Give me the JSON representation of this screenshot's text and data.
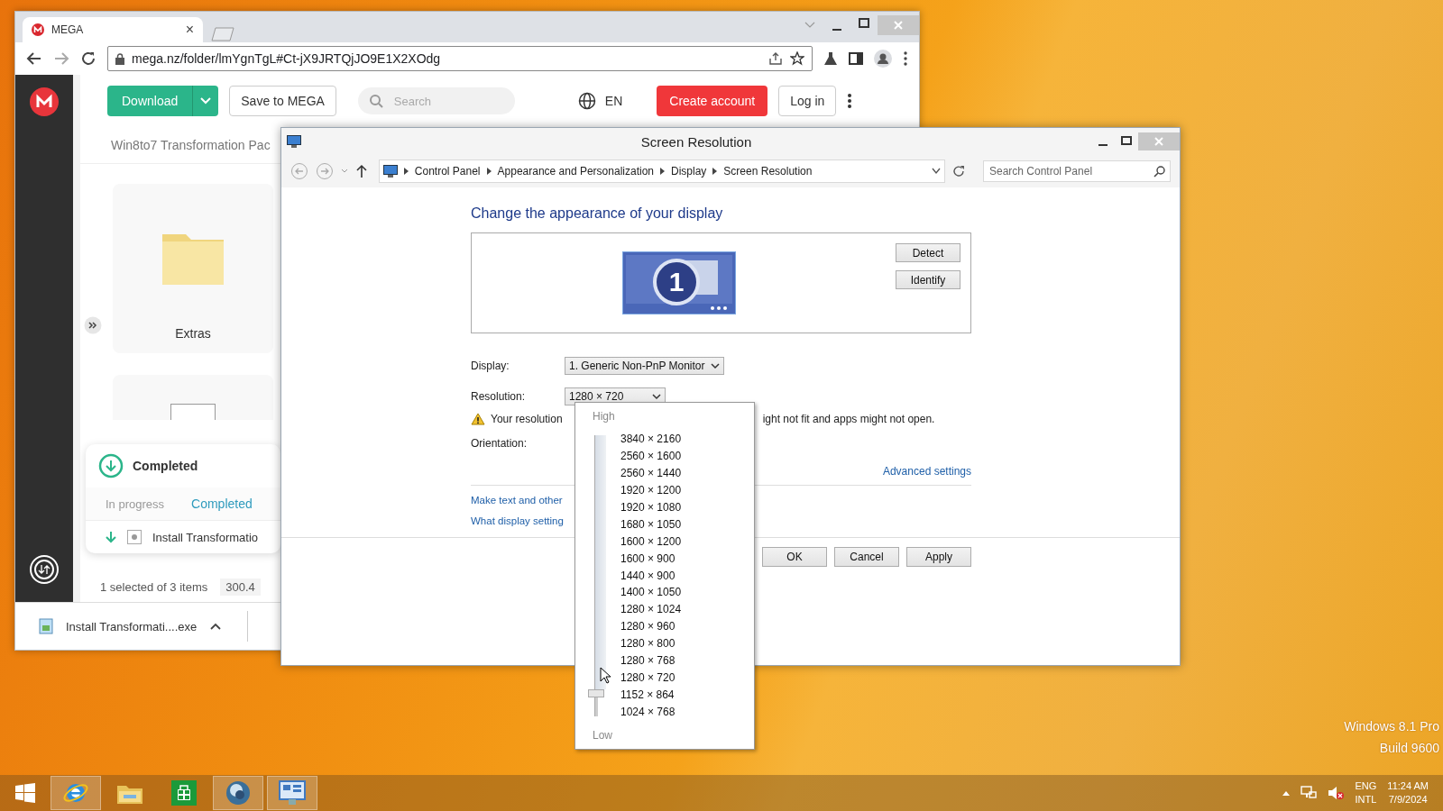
{
  "browser": {
    "tab": {
      "title": "MEGA",
      "close": "×"
    },
    "url": "mega.nz/folder/lmYgnTgL#Ct-jX9JRTQjJO9E1X2XOdg",
    "header": {
      "download": "Download",
      "save": "Save to MEGA",
      "search_placeholder": "Search",
      "language": "EN",
      "create_account": "Create account",
      "log_in": "Log in"
    },
    "breadcrumb": "Win8to7 Transformation Pac",
    "folders": [
      {
        "name": "Extras"
      }
    ],
    "transfers": {
      "title": "Completed",
      "tabs": [
        {
          "label": "In progress",
          "selected": false
        },
        {
          "label": "Completed",
          "selected": true
        }
      ],
      "items": [
        {
          "name": "Install Transformatio"
        }
      ]
    },
    "status": {
      "selection": "1 selected of 3 items",
      "size": "300.4"
    },
    "download_shelf": {
      "file": "Install Transformati....exe"
    }
  },
  "dialog": {
    "title": "Screen Resolution",
    "breadcrumb": [
      "Control Panel",
      "Appearance and Personalization",
      "Display",
      "Screen Resolution"
    ],
    "search_placeholder": "Search Control Panel",
    "heading": "Change the appearance of your display",
    "monitor_number": "1",
    "buttons": [
      "Detect",
      "Identify"
    ],
    "display": {
      "label": "Display:",
      "value": "1. Generic Non-PnP Monitor"
    },
    "resolution": {
      "label": "Resolution:",
      "value": "1280 × 720"
    },
    "warning": [
      "Your resolution",
      "ight not fit and apps might not open."
    ],
    "orientation_label": "Orientation:",
    "advanced_link": "Advanced settings",
    "links": [
      "Make text and other",
      "What display setting"
    ],
    "actions": [
      "OK",
      "Cancel",
      "Apply"
    ],
    "resolution_popup": {
      "high": "High",
      "low": "Low",
      "level": 0.07,
      "options": [
        "3840 × 2160",
        "2560 × 1600",
        "2560 × 1440",
        "1920 × 1200",
        "1920 × 1080",
        "1680 × 1050",
        "1600 × 1200",
        "1600 × 900",
        "1440 × 900",
        "1400 × 1050",
        "1280 × 1024",
        "1280 × 960",
        "1280 × 800",
        "1280 × 768",
        "1280 × 720",
        "1152 × 864",
        "1024 × 768"
      ]
    }
  },
  "taskbar": {
    "apps": [
      {
        "kind": "ie",
        "running": true
      },
      {
        "kind": "explorer",
        "running": false
      },
      {
        "kind": "store",
        "running": false
      },
      {
        "kind": "globe",
        "running": true
      },
      {
        "kind": "control-panel",
        "running": true
      }
    ],
    "tray": {
      "language": "ENG",
      "layout": "INTL",
      "time": "11:24 AM",
      "date": "7/9/2024"
    }
  },
  "desktop": {
    "edition": "Windows 8.1 Pro",
    "build": "Build 9600"
  }
}
